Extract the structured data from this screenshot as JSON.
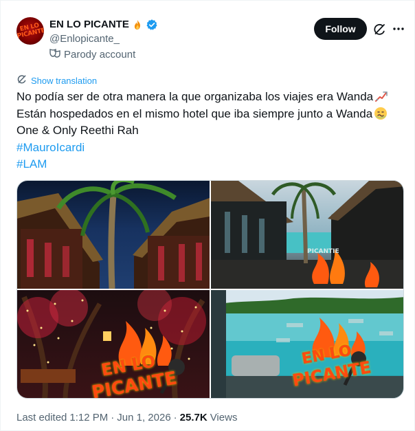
{
  "author": {
    "display_name": "EN LO PICANTE",
    "handle": "@Enlopicante_",
    "label": "Parody account",
    "avatar_text": "EN LO PICANTE"
  },
  "actions": {
    "follow_label": "Follow"
  },
  "tweet": {
    "show_translation": "Show translation",
    "lines": [
      "No podía ser de otra manera la que organizaba los viajes era Wanda",
      "Están hospedados en el mismo hotel que iba siempre junto a Wanda",
      "One & Only Reethi Rah"
    ],
    "hashtags": [
      "#MauroIcardi",
      "#LAM"
    ]
  },
  "media": {
    "watermark_lines": [
      "EN LO",
      "PICANTE"
    ],
    "watermark_small": "PICANTIE"
  },
  "footer": {
    "edited_label": "Last edited",
    "time": "1:12 PM",
    "date": "Jun 1, 2026",
    "separator": "·",
    "views_count": "25.7K",
    "views_label": "Views"
  },
  "colors": {
    "accent": "#1d9bf0",
    "text": "#0f1419",
    "muted": "#536471",
    "follow_bg": "#0f1419"
  },
  "icons": [
    "fire-icon",
    "verified-badge-icon",
    "parody-mask-icon",
    "grok-icon",
    "more-icon",
    "translate-icon",
    "chart-up-emoji-icon",
    "nauseated-face-emoji-icon",
    "microphone-icon"
  ]
}
